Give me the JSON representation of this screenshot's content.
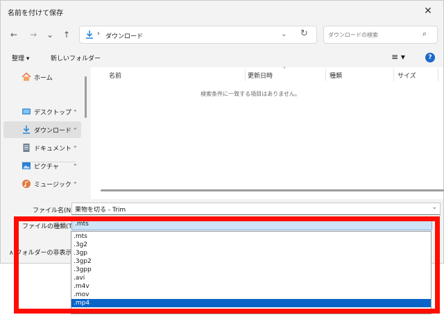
{
  "window": {
    "title": "名前を付けて保存",
    "close_glyph": "✕"
  },
  "nav": {
    "back": "←",
    "forward": "→",
    "recent": "⌄",
    "up": "↑"
  },
  "address": {
    "separator": "›",
    "path": "ダウンロード",
    "dropdown_glyph": "⌄",
    "refresh_glyph": "↻"
  },
  "search": {
    "placeholder": "ダウンロードの検索",
    "icon": "search-icon"
  },
  "toolbar": {
    "organize": "整理 ▾",
    "new_folder": "新しいフォルダー",
    "view_glyph": "≡ ▾",
    "help_glyph": "?"
  },
  "sidebar": {
    "items": [
      {
        "label": "ホーム",
        "icon": "home-icon"
      },
      {
        "label": "デスクトップ",
        "icon": "desktop-icon",
        "pinned": true
      },
      {
        "label": "ダウンロード",
        "icon": "download-icon",
        "pinned": true,
        "selected": true
      },
      {
        "label": "ドキュメント",
        "icon": "document-icon",
        "pinned": true
      },
      {
        "label": "ピクチャ",
        "icon": "pictures-icon",
        "pinned": true
      },
      {
        "label": "ミュージック",
        "icon": "music-icon",
        "pinned": true
      }
    ],
    "pin_glyph": "📌"
  },
  "filelist": {
    "columns": [
      "名前",
      "更新日時",
      "種類",
      "サイズ"
    ],
    "empty_message": "検索条件に一致する項目はありません。"
  },
  "filename": {
    "label": "ファイル名(N):",
    "value": "果物を切る - Trim",
    "chevron": "⌄"
  },
  "filetype": {
    "label": "ファイルの種類(T):",
    "selected": ".mts",
    "options": [
      ".mts",
      ".3g2",
      ".3gp",
      ".3gp2",
      ".3gpp",
      ".avi",
      ".m4v",
      ".mov",
      ".mp4"
    ],
    "highlighted_option": ".mp4"
  },
  "hide_folders": "∧ フォルダーの非表示",
  "colors": {
    "highlight_box": "#ff0d00",
    "selection": "#0a64c8",
    "accent": "#1b6ac9"
  }
}
